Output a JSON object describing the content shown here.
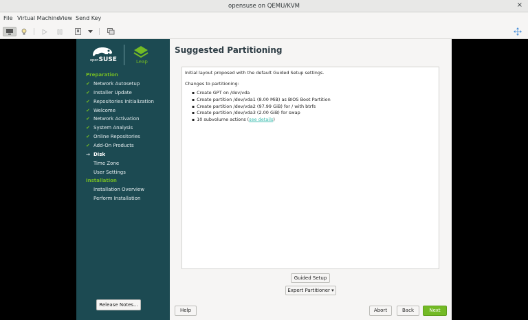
{
  "window": {
    "title": "opensuse on QEMU/KVM",
    "close_glyph": "×"
  },
  "menu": [
    "File",
    "Virtual Machine",
    "View",
    "Send Key"
  ],
  "toolbar": {
    "icons": [
      "monitor-icon",
      "bulb-icon",
      "play-icon",
      "pause-icon",
      "power-icon",
      "dropdown-arrow-icon",
      "snapshot-icon",
      "resize-icon"
    ]
  },
  "sidebar": {
    "logo_opensuse_prefix": "open",
    "logo_opensuse_word": "SUSE",
    "logo_leap": "Leap",
    "sections": [
      {
        "title": "Preparation",
        "steps": [
          {
            "label": "Network Autosetup",
            "state": "done"
          },
          {
            "label": "Installer Update",
            "state": "done"
          },
          {
            "label": "Repositories Initialization",
            "state": "done"
          },
          {
            "label": "Welcome",
            "state": "done"
          },
          {
            "label": "Network Activation",
            "state": "done"
          },
          {
            "label": "System Analysis",
            "state": "done"
          },
          {
            "label": "Online Repositories",
            "state": "done"
          },
          {
            "label": "Add-On Products",
            "state": "done"
          },
          {
            "label": "Disk",
            "state": "current"
          },
          {
            "label": "Time Zone",
            "state": "todo"
          },
          {
            "label": "User Settings",
            "state": "todo"
          }
        ]
      },
      {
        "title": "Installation",
        "steps": [
          {
            "label": "Installation Overview",
            "state": "todo"
          },
          {
            "label": "Perform Installation",
            "state": "todo"
          }
        ]
      }
    ],
    "release_notes": "Release Notes...",
    "colors": {
      "background": "#1c4a52",
      "accent": "#73ba25"
    }
  },
  "main": {
    "heading": "Suggested Partitioning",
    "intro": "Initial layout proposed with the default Guided Setup settings.",
    "changes_title": "Changes to partitioning:",
    "changes": [
      "Create GPT on /dev/vda",
      "Create partition /dev/vda1 (8.00 MiB) as BIOS Boot Partition",
      "Create partition /dev/vda2 (97.99 GiB) for / with btrfs",
      "Create partition /dev/vda3 (2.00 GiB) for swap"
    ],
    "subvolume_text": "10 subvolume actions (",
    "subvolume_link": "see details",
    "subvolume_close": ")",
    "guided_setup": "Guided Setup",
    "expert_partitioner": "Expert Partitioner ▾"
  },
  "footer": {
    "help": "Help",
    "abort": "Abort",
    "back": "Back",
    "next": "Next"
  }
}
